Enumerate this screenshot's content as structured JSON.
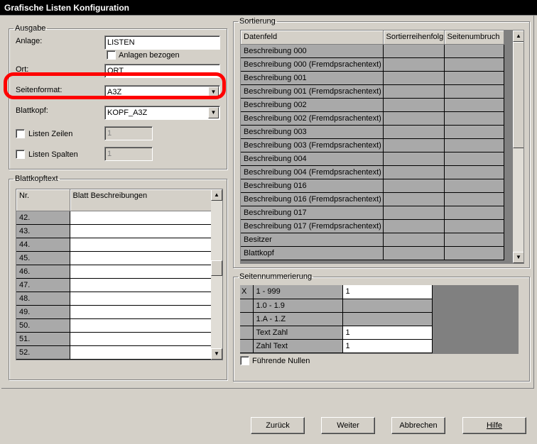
{
  "window": {
    "title": "Grafische Listen Konfiguration"
  },
  "ausgabe": {
    "legend": "Ausgabe",
    "anlage_label": "Anlage:",
    "anlage_value": "LISTEN",
    "anlagen_bezogen_label": "Anlagen bezogen",
    "ort_label": "Ort:",
    "ort_value": "ORT",
    "seitenformat_label": "Seitenformat:",
    "seitenformat_value": "A3Z",
    "blattkopf_label": "Blattkopf:",
    "blattkopf_value": "KOPF_A3Z",
    "listen_zeilen_label": "Listen Zeilen",
    "listen_zeilen_value": "1",
    "listen_spalten_label": "Listen Spalten",
    "listen_spalten_value": "1"
  },
  "blattkopftext": {
    "legend": "Blattkopftext",
    "headers": [
      "Nr.",
      "Blatt Beschreibungen"
    ],
    "rows": [
      "42.",
      "43.",
      "44.",
      "45.",
      "46.",
      "47.",
      "48.",
      "49.",
      "50.",
      "51.",
      "52."
    ]
  },
  "sortierung": {
    "legend": "Sortierung",
    "headers": [
      "Datenfeld",
      "Sortierreihenfolg",
      "Seitenumbruch"
    ],
    "rows": [
      "Beschreibung 000",
      "Beschreibung 000 (Fremdpsrachentext)",
      "Beschreibung 001",
      "Beschreibung 001 (Fremdpsrachentext)",
      "Beschreibung 002",
      "Beschreibung 002 (Fremdpsrachentext)",
      "Beschreibung 003",
      "Beschreibung 003 (Fremdpsrachentext)",
      "Beschreibung 004",
      "Beschreibung 004 (Fremdpsrachentext)",
      "Beschreibung 016",
      "Beschreibung 016 (Fremdpsrachentext)",
      "Beschreibung 017",
      "Beschreibung 017 (Fremdpsrachentext)",
      "Besitzer",
      "Blattkopf"
    ]
  },
  "seitennummerierung": {
    "legend": "Seitennummerierung",
    "rows": [
      {
        "mark": "X",
        "format": "1   - 999",
        "value": "1"
      },
      {
        "mark": "",
        "format": "1.0 - 1.9",
        "value": ""
      },
      {
        "mark": "",
        "format": "1.A - 1.Z",
        "value": ""
      },
      {
        "mark": "",
        "format": "Text Zahl",
        "value": "1"
      },
      {
        "mark": "",
        "format": "Zahl Text",
        "value": "1"
      }
    ],
    "fuehrende_nullen_label": "Führende Nullen"
  },
  "buttons": {
    "zurueck": "Zurück",
    "weiter": "Weiter",
    "abbrechen": "Abbrechen",
    "hilfe": "Hilfe"
  },
  "annotation": {
    "color": "#ff0000"
  }
}
